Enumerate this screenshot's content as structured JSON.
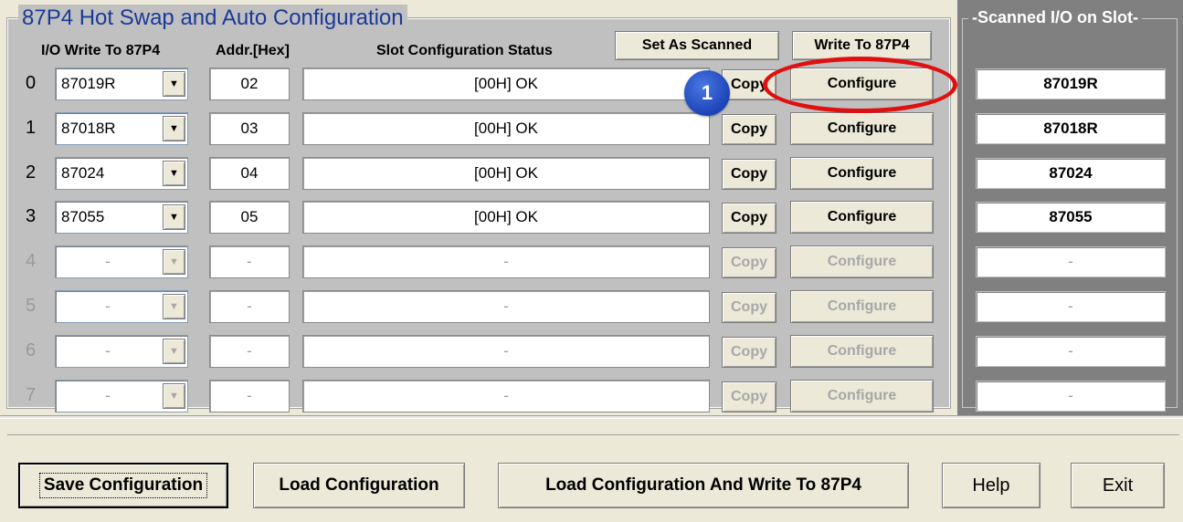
{
  "group_title": "87P4 Hot Swap and Auto Configuration",
  "headers": {
    "io_write": "I/O Write To 87P4",
    "addr": "Addr.[Hex]",
    "status": "Slot Configuration Status"
  },
  "top_buttons": {
    "set_as_scanned": "Set As Scanned",
    "write_to_87p4": "Write To 87P4"
  },
  "scan_panel_title": "Scanned I/O on Slot",
  "rows": [
    {
      "num": "0",
      "module": "87019R",
      "addr": "02",
      "status": "[00H] OK",
      "copy": "Copy",
      "configure": "Configure",
      "scanned": "87019R"
    },
    {
      "num": "1",
      "module": "87018R",
      "addr": "03",
      "status": "[00H] OK",
      "copy": "Copy",
      "configure": "Configure",
      "scanned": "87018R"
    },
    {
      "num": "2",
      "module": "87024",
      "addr": "04",
      "status": "[00H] OK",
      "copy": "Copy",
      "configure": "Configure",
      "scanned": "87024"
    },
    {
      "num": "3",
      "module": "87055",
      "addr": "05",
      "status": "[00H] OK",
      "copy": "Copy",
      "configure": "Configure",
      "scanned": "87055"
    },
    {
      "num": "4",
      "module": "-",
      "addr": "-",
      "status": "-",
      "copy": "Copy",
      "configure": "Configure",
      "scanned": "-"
    },
    {
      "num": "5",
      "module": "-",
      "addr": "-",
      "status": "-",
      "copy": "Copy",
      "configure": "Configure",
      "scanned": "-"
    },
    {
      "num": "6",
      "module": "-",
      "addr": "-",
      "status": "-",
      "copy": "Copy",
      "configure": "Configure",
      "scanned": "-"
    },
    {
      "num": "7",
      "module": "-",
      "addr": "-",
      "status": "-",
      "copy": "Copy",
      "configure": "Configure",
      "scanned": "-"
    }
  ],
  "bottom_buttons": {
    "save": "Save Configuration",
    "load": "Load Configuration",
    "load_write": "Load  Configuration And Write To 87P4",
    "help": "Help",
    "exit": "Exit"
  },
  "annotation": {
    "badge_number": "1",
    "highlight_color": "#e01010",
    "badge_color": "#1b44b8"
  },
  "icons": {
    "dropdown_arrow": "chevron-down-icon"
  }
}
